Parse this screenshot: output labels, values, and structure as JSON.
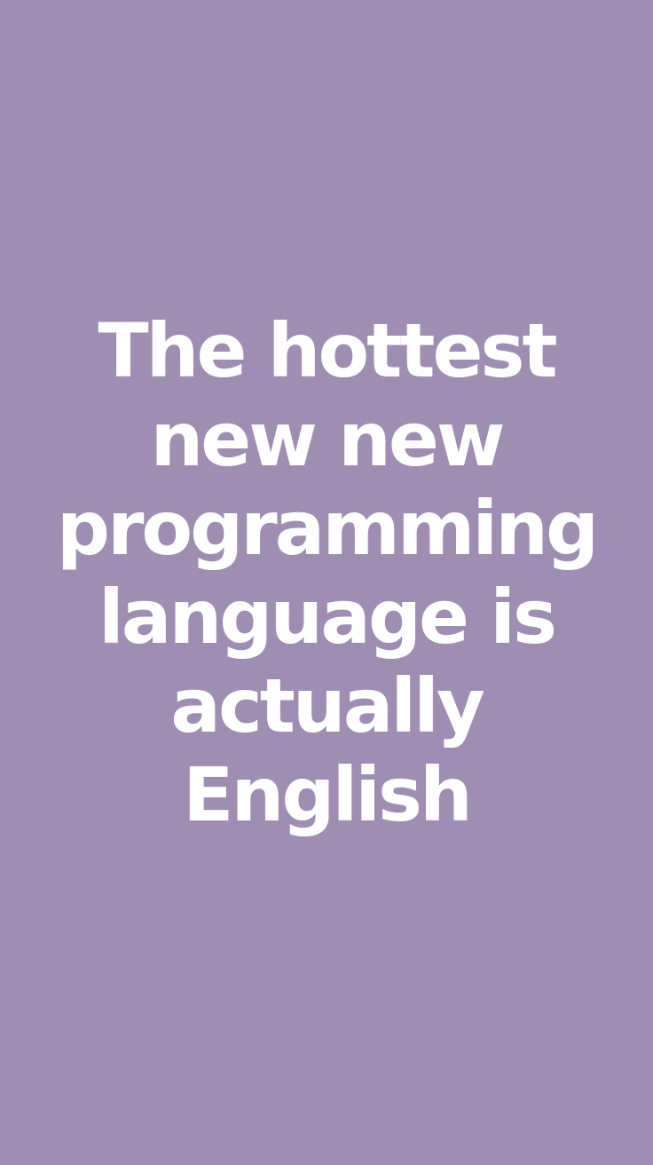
{
  "colors": {
    "background": "#a08db4",
    "text": "#ffffff"
  },
  "headline": {
    "lines": [
      "The hottest",
      "new new",
      "programming",
      "language is",
      "actually",
      "English"
    ]
  }
}
